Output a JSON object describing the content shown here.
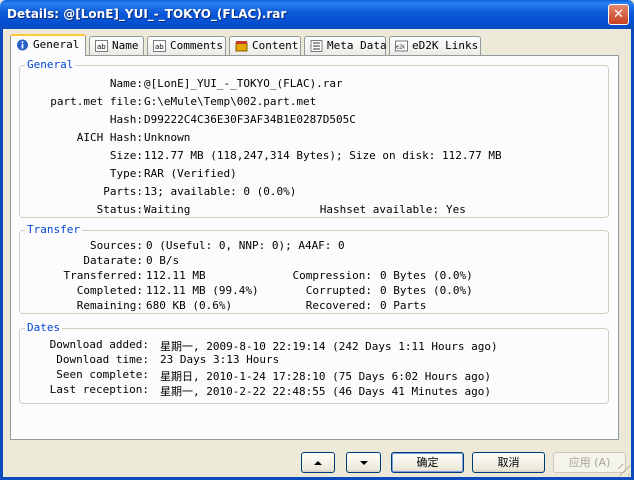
{
  "window": {
    "title": "Details: @[LonE]_YUI_-_TOKYO_(FLAC).rar",
    "close": "✕"
  },
  "tabs": [
    {
      "label": "General",
      "icon": "info-icon"
    },
    {
      "label": "Name",
      "icon": "name-icon"
    },
    {
      "label": "Comments",
      "icon": "comments-icon"
    },
    {
      "label": "Content",
      "icon": "content-icon"
    },
    {
      "label": "Meta Data",
      "icon": "metadata-icon"
    },
    {
      "label": "eD2K Links",
      "icon": "ed2k-icon"
    }
  ],
  "general": {
    "title": "General",
    "name_label": "Name:",
    "name": "@[LonE]_YUI_-_TOKYO_(FLAC).rar",
    "partmet_label": "part.met file:",
    "partmet": "G:\\eMule\\Temp\\002.part.met",
    "hash_label": "Hash:",
    "hash": "D99222C4C36E30F3AF34B1E0287D505C",
    "aich_label": "AICH Hash:",
    "aich": "Unknown",
    "size_label": "Size:",
    "size": "112.77 MB  (118,247,314 Bytes);  Size on disk:  112.77 MB",
    "type_label": "Type:",
    "type": "RAR  (Verified)",
    "parts_label": "Parts:",
    "parts": "13;  available: 0 (0.0%)",
    "status_label": "Status:",
    "status": "Waiting",
    "hashset_label": "Hashset available:",
    "hashset": "Yes"
  },
  "transfer": {
    "title": "Transfer",
    "sources_label": "Sources:",
    "sources": "0  (Useful: 0, NNP: 0);  A4AF: 0",
    "datarate_label": "Datarate:",
    "datarate": "0 B/s",
    "transferred_label": "Transferred:",
    "transferred": "112.11 MB",
    "compression_label": "Compression:",
    "compression": "0 Bytes (0.0%)",
    "completed_label": "Completed:",
    "completed": "112.11 MB (99.4%)",
    "corrupted_label": "Corrupted:",
    "corrupted": "0 Bytes (0.0%)",
    "remaining_label": "Remaining:",
    "remaining": "680 KB (0.6%)",
    "recovered_label": "Recovered:",
    "recovered": "0 Parts"
  },
  "dates": {
    "title": "Dates",
    "added_label": "Download added:",
    "added": "星期一, 2009-8-10 22:19:14   (242 Days 1:11 Hours ago)",
    "time_label": "Download time:",
    "time": "23 Days 3:13 Hours",
    "seen_label": "Seen complete:",
    "seen": "星期日, 2010-1-24 17:28:10   (75 Days 6:02 Hours ago)",
    "reception_label": "Last reception:",
    "reception": "星期一, 2010-2-22 22:48:55   (46 Days 41 Minutes ago)"
  },
  "buttons": {
    "ok": "确定",
    "cancel": "取消",
    "apply": "应用 (A)"
  }
}
